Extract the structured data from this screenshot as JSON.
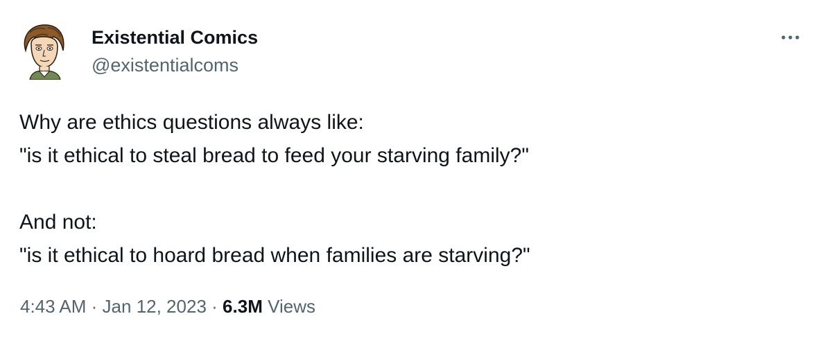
{
  "author": {
    "display_name": "Existential Comics",
    "handle": "@existentialcoms",
    "avatar_icon": "cartoon-portrait-avatar"
  },
  "menu": {
    "icon": "more-options-icon"
  },
  "tweet": {
    "text": "Why are ethics questions always like:\n\"is it ethical to steal bread to feed your starving family?\"\n\nAnd not:\n\"is it ethical to hoard bread when families are starving?\""
  },
  "meta": {
    "time": "4:43 AM",
    "separator": "·",
    "date": "Jan 12, 2023",
    "views_count": "6.3M",
    "views_label": "Views"
  },
  "colors": {
    "text_primary": "#0f1419",
    "text_secondary": "#536471"
  }
}
